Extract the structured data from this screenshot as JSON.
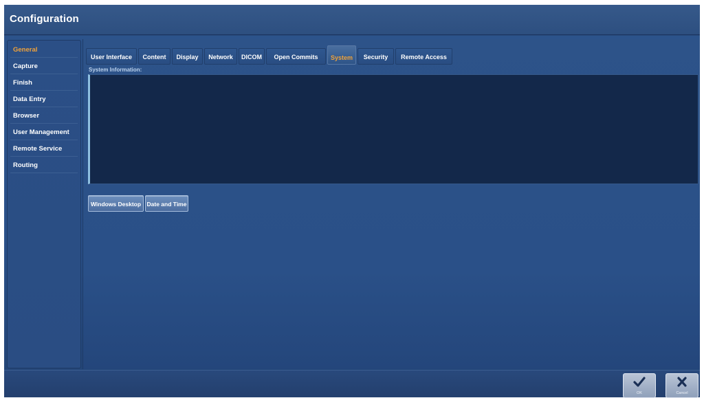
{
  "window": {
    "title": "Configuration"
  },
  "sidebar": {
    "items": [
      {
        "label": "General",
        "active": true
      },
      {
        "label": "Capture"
      },
      {
        "label": "Finish"
      },
      {
        "label": "Data Entry"
      },
      {
        "label": "Browser"
      },
      {
        "label": "User Management"
      },
      {
        "label": "Remote Service"
      },
      {
        "label": "Routing"
      }
    ]
  },
  "tabs": [
    {
      "label": "User Interface"
    },
    {
      "label": "Content"
    },
    {
      "label": "Display"
    },
    {
      "label": "Network"
    },
    {
      "label": "DICOM"
    },
    {
      "label": "Open Commits"
    },
    {
      "label": "System",
      "active": true
    },
    {
      "label": "Security"
    },
    {
      "label": "Remote Access"
    }
  ],
  "system": {
    "section_label": "System Information:",
    "info_text": "",
    "buttons": {
      "windows_desktop": "Windows Desktop",
      "date_and_time": "Date and Time"
    }
  },
  "footer": {
    "ok_label": "OK",
    "cancel_label": "Cancel",
    "ok_icon": "checkmark-icon",
    "cancel_icon": "close-icon"
  },
  "colors": {
    "accent_active": "#f0a23a",
    "background": "#27497a",
    "info_box": "#13284a"
  }
}
